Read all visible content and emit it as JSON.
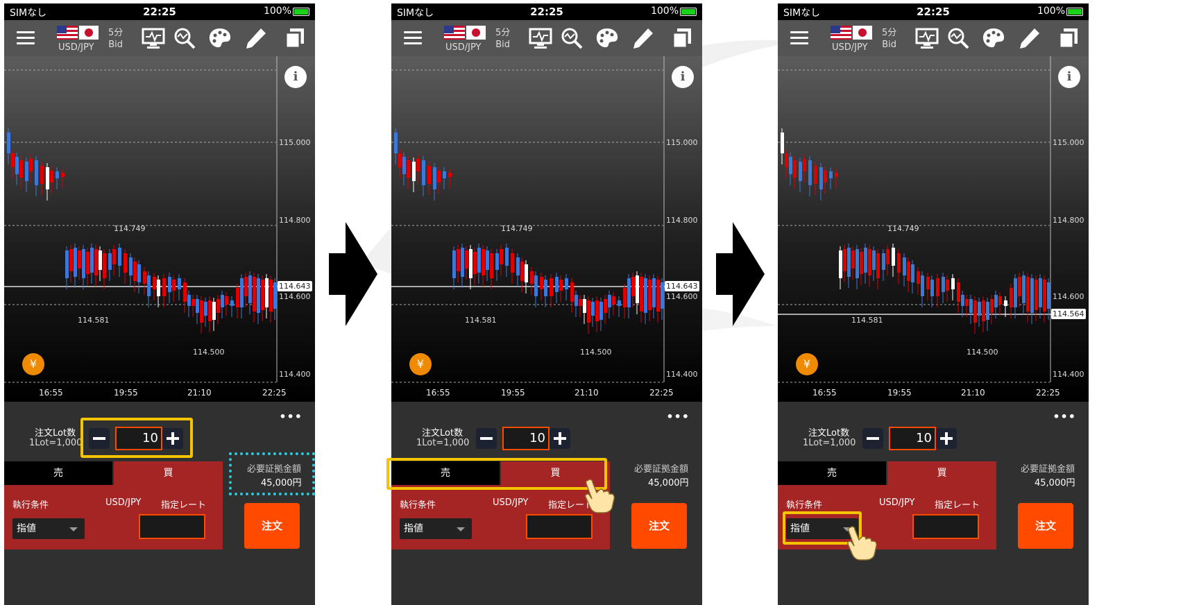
{
  "colors": {
    "accent_orange": "#ff4a00",
    "buy_red": "#a52424",
    "highlight_yellow": "#f5c400",
    "highlight_cyan": "#2ec8d8",
    "bull_candle": "#3c78d8",
    "bear_candle": "#e00000"
  },
  "screens": [
    {
      "status": {
        "carrier": "SIMなし",
        "time": "22:25",
        "battery": "100%"
      },
      "toolbar": {
        "pair": "USD/JPY",
        "timeframe": "5分",
        "price_type": "Bid"
      },
      "chart": {
        "y_ticks": [
          "115.000",
          "114.800",
          "114.600",
          "114.400"
        ],
        "current_price": "114.643",
        "x_ticks": [
          "16:55",
          "19:55",
          "21:10",
          "22:25"
        ],
        "annotations": [
          "114.749",
          "114.581",
          "114.500"
        ]
      },
      "order": {
        "lot_label": "注文Lot数",
        "lot_unit": "1Lot=1,000",
        "lot_value": "10",
        "more": "•••",
        "sell_tab": "売",
        "buy_tab": "買",
        "condition_label": "執行条件",
        "pair": "USD/JPY",
        "rate_label": "指定レート",
        "condition_value": "指値",
        "margin_label": "必要証拠金額",
        "margin_value": "45,000円",
        "order_button": "注文"
      }
    },
    {
      "status": {
        "carrier": "SIMなし",
        "time": "22:25",
        "battery": "100%"
      },
      "toolbar": {
        "pair": "USD/JPY",
        "timeframe": "5分",
        "price_type": "Bid"
      },
      "chart": {
        "y_ticks": [
          "115.000",
          "114.800",
          "114.600",
          "114.400"
        ],
        "current_price": "114.643",
        "x_ticks": [
          "16:55",
          "19:55",
          "21:10",
          "22:25"
        ],
        "annotations": [
          "114.749",
          "114.581",
          "114.500"
        ]
      },
      "order": {
        "lot_label": "注文Lot数",
        "lot_unit": "1Lot=1,000",
        "lot_value": "10",
        "more": "•••",
        "sell_tab": "売",
        "buy_tab": "買",
        "condition_label": "執行条件",
        "pair": "USD/JPY",
        "rate_label": "指定レート",
        "condition_value": "指値",
        "margin_label": "必要証拠金額",
        "margin_value": "45,000円",
        "order_button": "注文"
      }
    },
    {
      "status": {
        "carrier": "SIMなし",
        "time": "22:25",
        "battery": "100%"
      },
      "toolbar": {
        "pair": "USD/JPY",
        "timeframe": "5分",
        "price_type": "Bid"
      },
      "chart": {
        "y_ticks": [
          "115.000",
          "114.800",
          "114.600",
          "114.400"
        ],
        "current_price": "114.564",
        "x_ticks": [
          "16:55",
          "19:55",
          "21:10",
          "22:25"
        ],
        "annotations": [
          "114.749",
          "114.581",
          "114.500"
        ]
      },
      "order": {
        "lot_label": "注文Lot数",
        "lot_unit": "1Lot=1,000",
        "lot_value": "10",
        "more": "•••",
        "sell_tab": "売",
        "buy_tab": "買",
        "condition_label": "執行条件",
        "pair": "USD/JPY",
        "rate_label": "指定レート",
        "condition_value": "指値",
        "margin_label": "必要証拠金額",
        "margin_value": "45,000円",
        "order_button": "注文"
      }
    }
  ]
}
